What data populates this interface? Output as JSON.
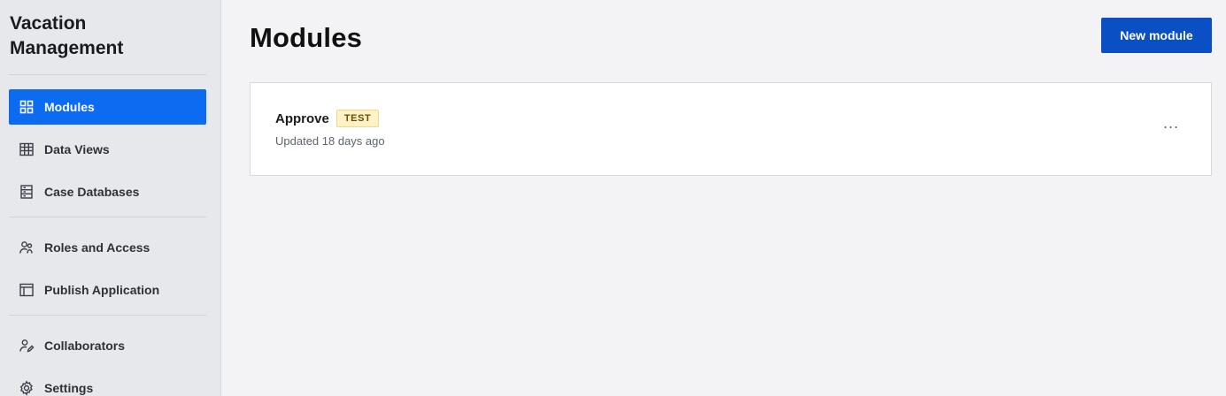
{
  "sidebar": {
    "app_title_line1": "Vacation",
    "app_title_line2": "Management",
    "items": [
      {
        "label": "Modules",
        "icon": "grid-icon",
        "active": true
      },
      {
        "label": "Data Views",
        "icon": "table-icon"
      },
      {
        "label": "Case Databases",
        "icon": "database-icon"
      },
      {
        "label": "Roles and Access",
        "icon": "users-icon"
      },
      {
        "label": "Publish Application",
        "icon": "layout-icon"
      },
      {
        "label": "Collaborators",
        "icon": "collaborator-icon"
      },
      {
        "label": "Settings",
        "icon": "gear-icon"
      }
    ]
  },
  "main": {
    "title": "Modules",
    "new_button_label": "New module",
    "modules": [
      {
        "name": "Approve",
        "badge": "TEST",
        "updated": "Updated 18 days ago",
        "menu": "..."
      }
    ]
  },
  "colors": {
    "accent": "#0b6cf2",
    "primary_button": "#0a4fc4",
    "badge_bg": "#fff2c6"
  }
}
